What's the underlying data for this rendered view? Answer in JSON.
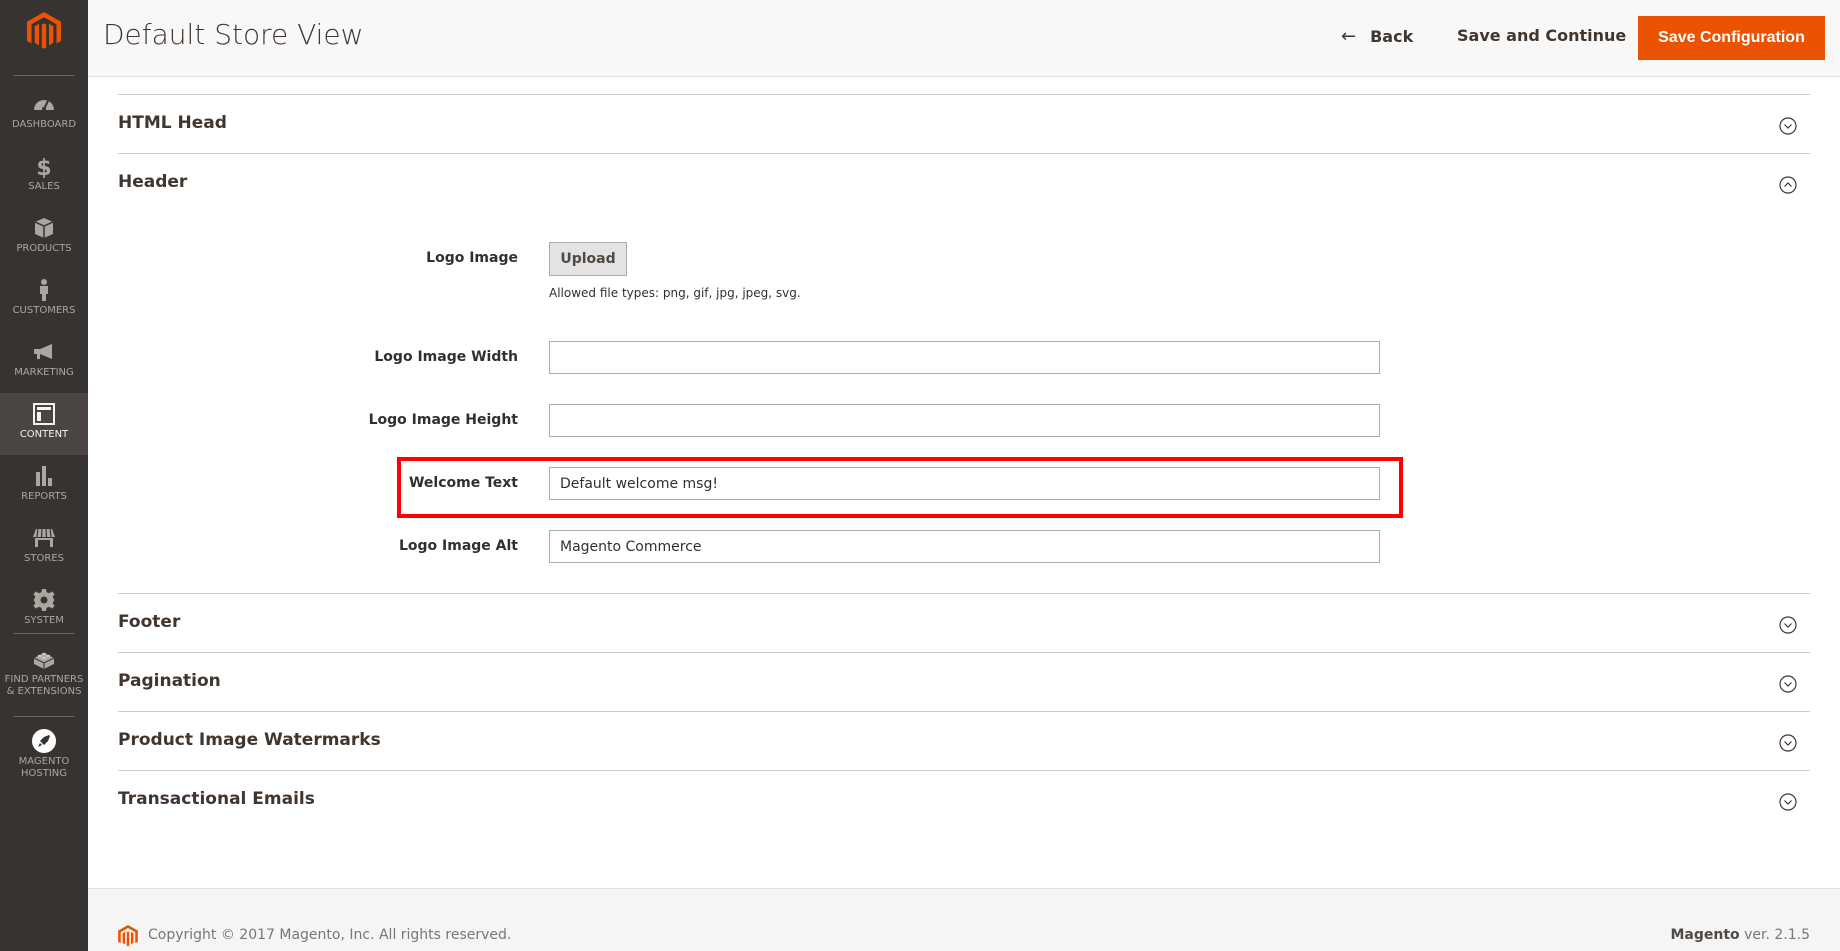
{
  "sidebar": {
    "items": [
      {
        "label": "DASHBOARD",
        "icon": "dashboard-icon"
      },
      {
        "label": "SALES",
        "icon": "dollar-icon"
      },
      {
        "label": "PRODUCTS",
        "icon": "box-icon"
      },
      {
        "label": "CUSTOMERS",
        "icon": "person-icon"
      },
      {
        "label": "MARKETING",
        "icon": "megaphone-icon"
      },
      {
        "label": "CONTENT",
        "icon": "layout-icon",
        "active": true
      },
      {
        "label": "REPORTS",
        "icon": "bar-chart-icon"
      },
      {
        "label": "STORES",
        "icon": "storefront-icon"
      },
      {
        "label": "SYSTEM",
        "icon": "gear-icon"
      },
      {
        "label": "FIND PARTNERS & EXTENSIONS",
        "label_line1": "FIND PARTNERS",
        "label_line2": "& EXTENSIONS",
        "icon": "lego-brick-icon"
      },
      {
        "label": "MAGENTO HOSTING",
        "label_line1": "MAGENTO",
        "label_line2": "HOSTING",
        "icon": "rocket-icon"
      }
    ]
  },
  "header": {
    "title": "Default Store View",
    "back_label": "Back",
    "save_continue_label": "Save and Continue",
    "save_config_label": "Save Configuration"
  },
  "sections": {
    "html_head": {
      "title": "HTML Head",
      "expanded": false
    },
    "header": {
      "title": "Header",
      "expanded": true,
      "fields": {
        "logo_image": {
          "label": "Logo Image",
          "button": "Upload",
          "note": "Allowed file types: png, gif, jpg, jpeg, svg."
        },
        "logo_width": {
          "label": "Logo Image Width",
          "value": ""
        },
        "logo_height": {
          "label": "Logo Image Height",
          "value": ""
        },
        "welcome_text": {
          "label": "Welcome Text",
          "value": "Default welcome msg!"
        },
        "logo_alt": {
          "label": "Logo Image Alt",
          "value": "Magento Commerce"
        }
      }
    },
    "footer": {
      "title": "Footer",
      "expanded": false
    },
    "pagination": {
      "title": "Pagination",
      "expanded": false
    },
    "watermarks": {
      "title": "Product Image Watermarks",
      "expanded": false
    },
    "transactional": {
      "title": "Transactional Emails",
      "expanded": false
    }
  },
  "footer": {
    "copyright": "Copyright © 2017 Magento, Inc. All rights reserved.",
    "brand": "Magento",
    "version": " ver. 2.1.5"
  },
  "colors": {
    "accent": "#eb5202",
    "sidebar_bg": "#373330",
    "highlight": "#ff0000"
  }
}
